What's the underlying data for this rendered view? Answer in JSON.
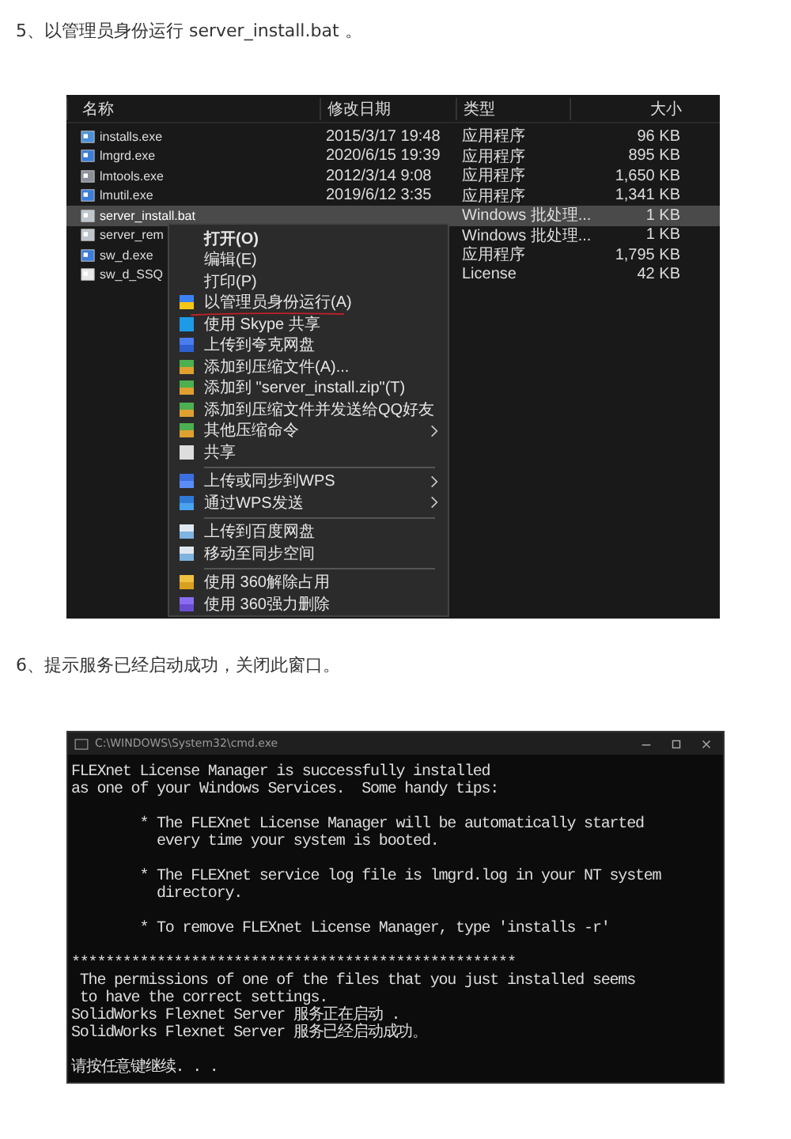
{
  "steps": [
    {
      "text": "5、以管理员身份运行 server_install.bat 。",
      "explorer": {
        "columns": [
          "名称",
          "修改日期",
          "类型",
          "大小"
        ],
        "rows": [
          {
            "kind": "installer",
            "name": "installs.exe",
            "date": "2015/3/17 19:48",
            "type": "应用程序",
            "size": "96 KB",
            "selected": false
          },
          {
            "kind": "exe",
            "name": "lmgrd.exe",
            "date": "2020/6/15 19:39",
            "type": "应用程序",
            "size": "895 KB",
            "selected": false
          },
          {
            "kind": "tool",
            "name": "lmtools.exe",
            "date": "2012/3/14 9:08",
            "type": "应用程序",
            "size": "1,650 KB",
            "selected": false
          },
          {
            "kind": "exe",
            "name": "lmutil.exe",
            "date": "2019/6/12 3:35",
            "type": "应用程序",
            "size": "1,341 KB",
            "selected": false
          },
          {
            "kind": "batch",
            "name": "server_install.bat",
            "type": "Windows 批处理...",
            "size": "1 KB",
            "selected": true
          },
          {
            "kind": "batch",
            "name": "server_rem",
            "type": "Windows 批处理...",
            "size": "1 KB",
            "selected": false
          },
          {
            "kind": "exe",
            "name": "sw_d.exe",
            "type": "应用程序",
            "size": "1,795 KB",
            "selected": false
          },
          {
            "kind": "file",
            "name": "sw_d_SSQ",
            "type": "License",
            "size": "42 KB",
            "selected": false
          }
        ],
        "context_menu": [
          [
            {
              "kind": "plain",
              "label": "打开(O)",
              "bold": true,
              "submenu": false
            },
            {
              "kind": "plain",
              "label": "编辑(E)",
              "bold": false,
              "submenu": false
            },
            {
              "kind": "plain",
              "label": "打印(P)",
              "bold": false,
              "submenu": false
            },
            {
              "kind": "shield",
              "label": "以管理员身份运行(A)",
              "bold": false,
              "submenu": false
            },
            {
              "kind": "skype",
              "label": "使用 Skype 共享",
              "bold": false,
              "submenu": false
            },
            {
              "kind": "cloud",
              "label": "上传到夸克网盘",
              "bold": false,
              "submenu": false
            },
            {
              "kind": "archive",
              "label": "添加到压缩文件(A)...",
              "bold": false,
              "submenu": false
            },
            {
              "kind": "archive",
              "label": "添加到 \"server_install.zip\"(T)",
              "bold": false,
              "submenu": false
            },
            {
              "kind": "archive",
              "label": "添加到压缩文件并发送给QQ好友",
              "bold": false,
              "submenu": false
            },
            {
              "kind": "archive",
              "label": "其他压缩命令",
              "bold": false,
              "submenu": true
            },
            {
              "kind": "share",
              "label": "共享",
              "bold": false,
              "submenu": false
            }
          ],
          [
            {
              "kind": "upload",
              "label": "上传或同步到WPS",
              "bold": false,
              "submenu": true
            },
            {
              "kind": "send",
              "label": "通过WPS发送",
              "bold": false,
              "submenu": true
            }
          ],
          [
            {
              "kind": "netdisk",
              "label": "上传到百度网盘",
              "bold": false,
              "submenu": false
            },
            {
              "kind": "netdisk",
              "label": "移动至同步空间",
              "bold": false,
              "submenu": false
            }
          ],
          [
            {
              "kind": "folder",
              "label": "使用 360解除占用",
              "bold": false,
              "submenu": false
            },
            {
              "kind": "purple",
              "label": "使用 360强力删除",
              "bold": false,
              "submenu": false
            }
          ]
        ]
      }
    },
    {
      "text": "6、提示服务已经启动成功，关闭此窗口。",
      "console": {
        "title": "C:\\WINDOWS\\System32\\cmd.exe",
        "blocks": [
          [
            "FLEXnet License Manager is successfully installed",
            "as one of your Windows Services.  Some handy tips:"
          ],
          [
            "        * The FLEXnet License Manager will be automatically started",
            "          every time your system is booted."
          ],
          [
            "        * The FLEXnet service log file is lmgrd.log in your NT system",
            "          directory."
          ],
          [
            "        * To remove FLEXnet License Manager, type 'installs -r'"
          ],
          [
            "****************************************************",
            " The permissions of one of the files that you just installed seems",
            " to have the correct settings.",
            "SolidWorks Flexnet Server 服务正在启动 .",
            "SolidWorks Flexnet Server 服务已经启动成功。"
          ],
          [
            "请按任意键继续. . ."
          ]
        ]
      }
    }
  ]
}
